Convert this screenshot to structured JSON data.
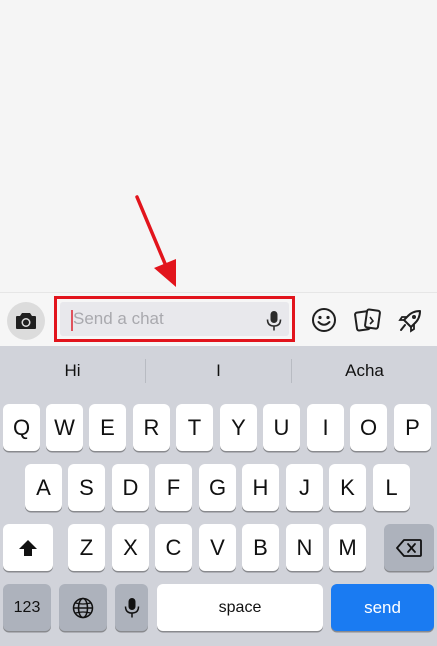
{
  "compose": {
    "placeholder": "Send a chat",
    "value": ""
  },
  "icons": {
    "camera": "camera-icon",
    "mic": "microphone-icon",
    "emoji": "smiley-icon",
    "cards": "cards-icon",
    "rocket": "rocket-icon",
    "globe": "globe-icon",
    "shift": "shift-arrow-icon",
    "backspace": "backspace-icon"
  },
  "annotation": {
    "highlight_color": "#e2141c"
  },
  "keyboard": {
    "suggestions": [
      "Hi",
      "I",
      "Acha"
    ],
    "row1": [
      "Q",
      "W",
      "E",
      "R",
      "T",
      "Y",
      "U",
      "I",
      "O",
      "P"
    ],
    "row2": [
      "A",
      "S",
      "D",
      "F",
      "G",
      "H",
      "J",
      "K",
      "L"
    ],
    "row3": [
      "Z",
      "X",
      "C",
      "V",
      "B",
      "N",
      "M"
    ],
    "numbers_label": "123",
    "space_label": "space",
    "send_label": "send",
    "send_color": "#1a7bf2"
  }
}
